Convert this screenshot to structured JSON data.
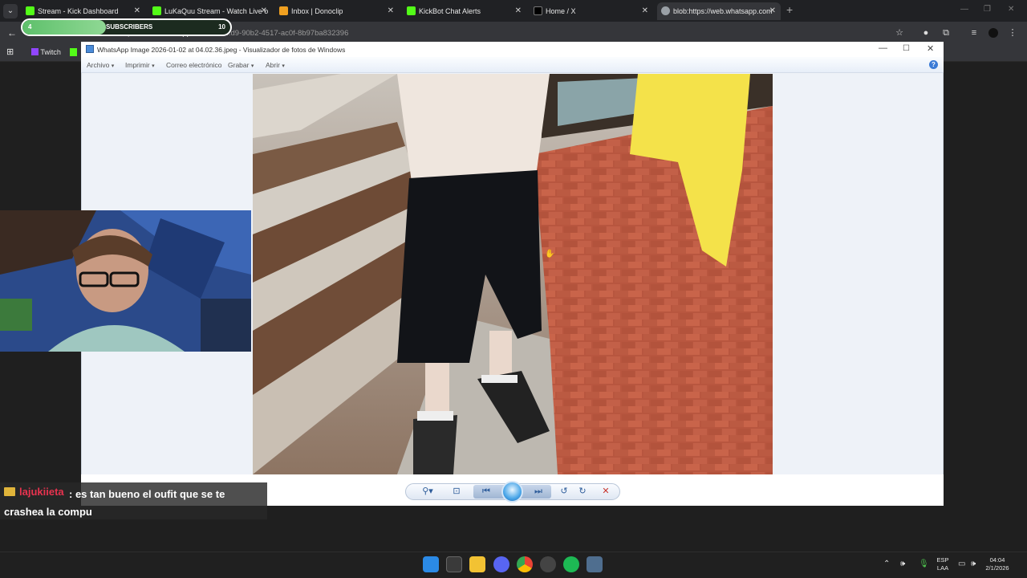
{
  "browser": {
    "tabs": [
      {
        "label": "Stream - Kick Dashboard",
        "favicon_color": "#53fc18",
        "active": false
      },
      {
        "label": "LuKaQuu Stream - Watch Live o",
        "favicon_color": "#53fc18",
        "active": false
      },
      {
        "label": "Inbox | Donoclip",
        "favicon_color": "#f0a020",
        "active": false
      },
      {
        "label": "KickBot Chat Alerts",
        "favicon_color": "#53fc18",
        "active": false
      },
      {
        "label": "Home / X",
        "favicon_color": "#000000",
        "active": false
      },
      {
        "label": "blob:https://web.whatsapp.com",
        "favicon_color": "#9aa0a6",
        "active": true
      }
    ],
    "address": {
      "url_prefix": "blob:https://",
      "url_host": "web.whatsapp.com",
      "url_rest": "/f832...d9-90b2-4517-ac0f-8b97ba832396"
    },
    "bookmarks": [
      {
        "label": "Twitch",
        "icon": "twitch-icon"
      }
    ]
  },
  "subscriber_goal": {
    "current": "4",
    "label": "SUBSCRIBERS",
    "goal": "10",
    "progress": 0.4
  },
  "photo_viewer": {
    "title": "WhatsApp Image 2026-01-02 at 04.02.36.jpeg - Visualizador de fotos de Windows",
    "menu": [
      "Archivo",
      "Imprimir",
      "Correo electrónico",
      "Grabar",
      "Abrir"
    ],
    "menu_has_dropdown": [
      true,
      true,
      false,
      true,
      true
    ],
    "toolbar_icons": [
      "zoom-icon",
      "actual-size-icon",
      "previous-icon",
      "slideshow-icon",
      "next-icon",
      "rotate-left-icon",
      "rotate-right-icon",
      "delete-icon"
    ]
  },
  "chat": {
    "username": "lajukiieta",
    "separator": " : ",
    "message": "es tan bueno el oufit que se te crashea la compu",
    "username_color": "#e8334f"
  },
  "taskbar": {
    "language_line1": "ESP",
    "language_line2": "LAA",
    "time": "04:04",
    "date": "2/1/2026"
  }
}
